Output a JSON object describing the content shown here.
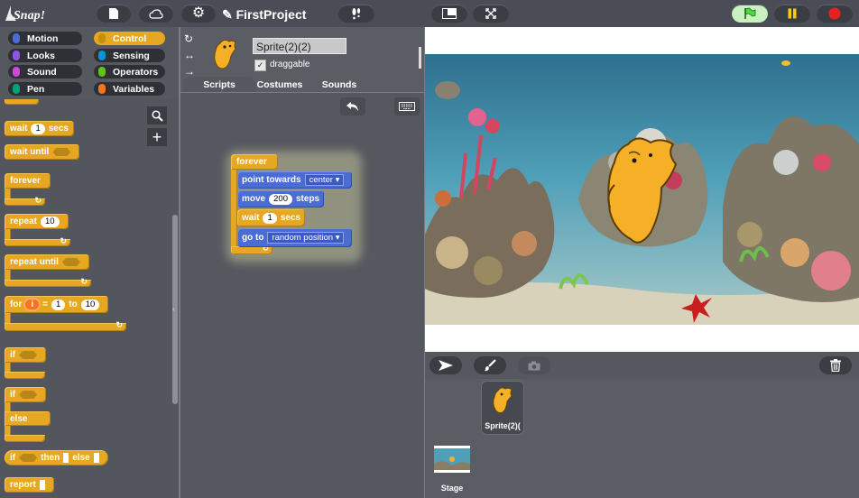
{
  "topbar": {
    "logo_text": "Snap!",
    "project_name": "✎ FirstProject"
  },
  "categories": [
    {
      "label": "Motion",
      "color": "#4a6cd4",
      "selected": false
    },
    {
      "label": "Control",
      "color": "#e6a822",
      "selected": true
    },
    {
      "label": "Looks",
      "color": "#8f56e3",
      "selected": false
    },
    {
      "label": "Sensing",
      "color": "#0494dc",
      "selected": false
    },
    {
      "label": "Sound",
      "color": "#cf4ad9",
      "selected": false
    },
    {
      "label": "Operators",
      "color": "#62c213",
      "selected": false
    },
    {
      "label": "Pen",
      "color": "#00a178",
      "selected": false
    },
    {
      "label": "Variables",
      "color": "#f3761d",
      "selected": false
    }
  ],
  "palette": {
    "wait_secs": {
      "w1": "wait",
      "val": "1",
      "w2": "secs"
    },
    "wait_until": "wait until",
    "forever": "forever",
    "repeat": {
      "label": "repeat",
      "val": "10"
    },
    "repeat_until": "repeat until",
    "for": {
      "w1": "for",
      "var": "i",
      "eq": "=",
      "from": "1",
      "to_word": "to",
      "to": "10"
    },
    "if1": "if",
    "if2": "if",
    "else": "else",
    "if_then_else": {
      "w1": "if",
      "w2": "then",
      "w3": "else"
    },
    "report": "report"
  },
  "sprite": {
    "name": "Sprite(2)(2)",
    "draggable_label": "draggable",
    "draggable_checked": "✓"
  },
  "tabs": {
    "scripts": "Scripts",
    "costumes": "Costumes",
    "sounds": "Sounds"
  },
  "script": {
    "forever": "forever",
    "point_towards": {
      "w1": "point",
      "w2": "towards",
      "target": "center"
    },
    "move": {
      "w1": "move",
      "val": "200",
      "w2": "steps"
    },
    "wait": {
      "w1": "wait",
      "val": "1",
      "w2": "secs"
    },
    "goto": {
      "w1": "go",
      "w2": "to",
      "target": "random position"
    }
  },
  "corral": {
    "sprite_label": "Sprite(2)(",
    "stage_label": "Stage"
  },
  "colors": {
    "control": "#e6a822",
    "motion": "#4a6cd4",
    "green_flag": "#4fdb3f",
    "pause": "#ffcc00",
    "stop": "#e8201f"
  }
}
